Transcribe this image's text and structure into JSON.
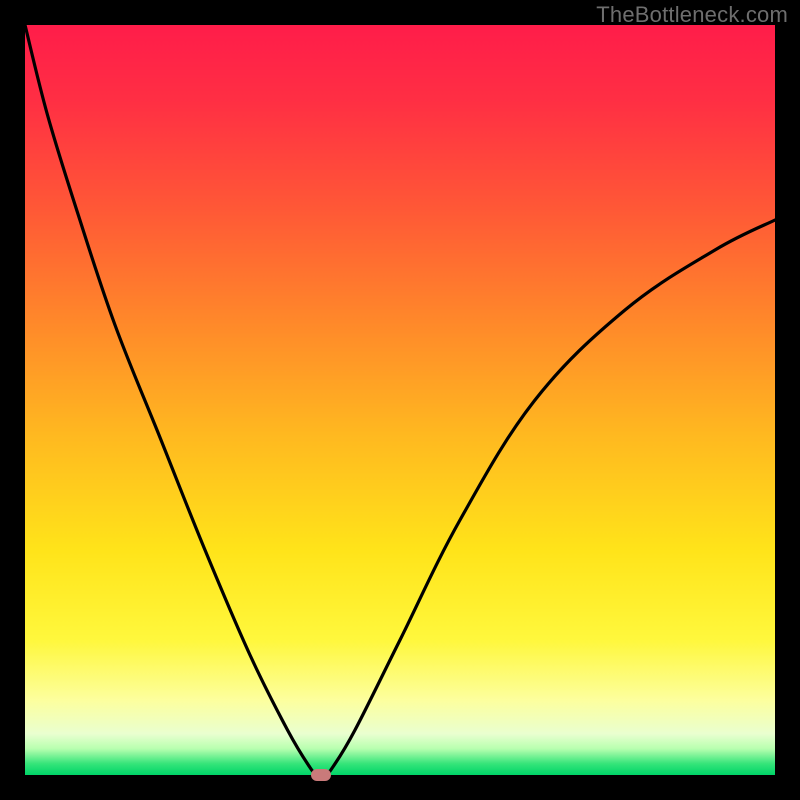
{
  "watermark": "TheBottleneck.com",
  "chart_data": {
    "type": "line",
    "title": "",
    "xlabel": "",
    "ylabel": "",
    "xlim": [
      0,
      100
    ],
    "ylim": [
      0,
      100
    ],
    "grid": false,
    "legend": false,
    "annotations": [],
    "background_gradient": {
      "top_color": "#ff1f4b",
      "mid_color": "#ffe100",
      "bottom_color": "#00e06a"
    },
    "series": [
      {
        "name": "bottleneck-curve",
        "color": "#000000",
        "x": [
          0,
          3,
          7,
          12,
          18,
          24,
          30,
          35,
          38,
          39,
          40,
          41,
          44,
          50,
          58,
          68,
          80,
          92,
          100
        ],
        "values": [
          100,
          88,
          75,
          60,
          45,
          30,
          16,
          6,
          1,
          0,
          0,
          1,
          6,
          18,
          34,
          50,
          62,
          70,
          74
        ]
      }
    ],
    "marker": {
      "x": 39.5,
      "y": 0,
      "color": "#c97a7a"
    }
  }
}
